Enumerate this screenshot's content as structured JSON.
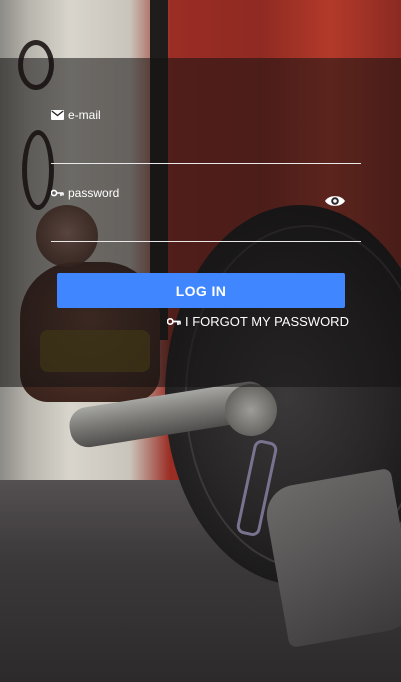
{
  "form": {
    "email_label": "e-mail",
    "email_value": "",
    "password_label": "password",
    "password_value": "",
    "login_label": "LOG IN",
    "forgot_label": "I FORGOT MY PASSWORD"
  },
  "icons": {
    "email": "envelope-icon",
    "password": "key-icon",
    "visibility": "eye-icon",
    "forgot": "key-icon"
  },
  "colors": {
    "accent": "#3f86ff",
    "text": "#ffffff",
    "overlay": "rgba(20,18,18,0.55)"
  }
}
